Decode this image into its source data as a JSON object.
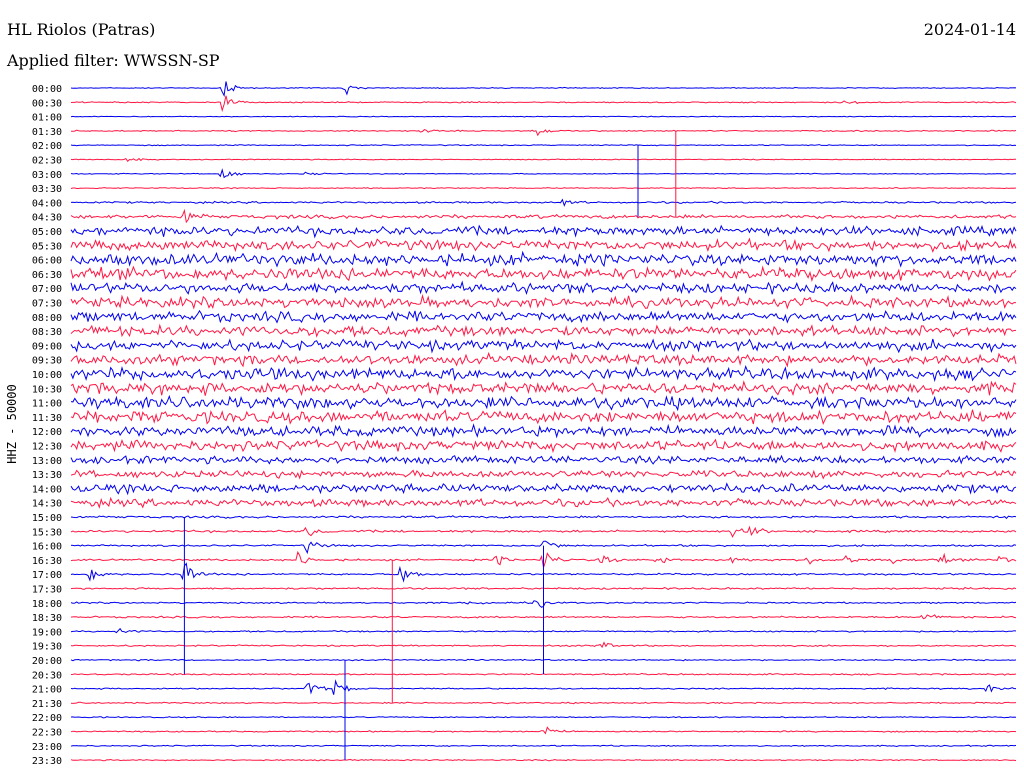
{
  "header": {
    "station": "HL Riolos (Patras)",
    "date": "2024-01-14",
    "filter": "Applied filter: WWSSN-SP"
  },
  "chart_data": {
    "type": "line",
    "title": "HL Riolos (Patras)",
    "ylabel": "HHZ - 50000",
    "colors": [
      "#0000ee",
      "#ff1744"
    ],
    "rows": [
      {
        "time": "00:00",
        "noise": 0.6
      },
      {
        "time": "00:30",
        "noise": 0.8
      },
      {
        "time": "01:00",
        "noise": 0.5
      },
      {
        "time": "01:30",
        "noise": 0.8
      },
      {
        "time": "02:00",
        "noise": 0.7
      },
      {
        "time": "02:30",
        "noise": 0.6
      },
      {
        "time": "03:00",
        "noise": 0.6
      },
      {
        "time": "03:30",
        "noise": 0.7
      },
      {
        "time": "04:00",
        "noise": 1.2
      },
      {
        "time": "04:30",
        "noise": 2.5
      },
      {
        "time": "05:00",
        "noise": 6
      },
      {
        "time": "05:30",
        "noise": 7
      },
      {
        "time": "06:00",
        "noise": 8
      },
      {
        "time": "06:30",
        "noise": 8
      },
      {
        "time": "07:00",
        "noise": 7
      },
      {
        "time": "07:30",
        "noise": 7
      },
      {
        "time": "08:00",
        "noise": 7
      },
      {
        "time": "08:30",
        "noise": 7
      },
      {
        "time": "09:00",
        "noise": 7
      },
      {
        "time": "09:30",
        "noise": 7
      },
      {
        "time": "10:00",
        "noise": 8
      },
      {
        "time": "10:30",
        "noise": 8
      },
      {
        "time": "11:00",
        "noise": 8
      },
      {
        "time": "11:30",
        "noise": 8
      },
      {
        "time": "12:00",
        "noise": 7
      },
      {
        "time": "12:30",
        "noise": 7
      },
      {
        "time": "13:00",
        "noise": 5
      },
      {
        "time": "13:30",
        "noise": 5
      },
      {
        "time": "14:00",
        "noise": 6
      },
      {
        "time": "14:30",
        "noise": 5
      },
      {
        "time": "15:00",
        "noise": 1.5
      },
      {
        "time": "15:30",
        "noise": 1.5
      },
      {
        "time": "16:00",
        "noise": 1.2
      },
      {
        "time": "16:30",
        "noise": 1.3
      },
      {
        "time": "17:00",
        "noise": 1.2
      },
      {
        "time": "17:30",
        "noise": 1.2
      },
      {
        "time": "18:00",
        "noise": 1.0
      },
      {
        "time": "18:30",
        "noise": 1.2
      },
      {
        "time": "19:00",
        "noise": 1.0
      },
      {
        "time": "19:30",
        "noise": 1.0
      },
      {
        "time": "20:00",
        "noise": 0.9
      },
      {
        "time": "20:30",
        "noise": 1.0
      },
      {
        "time": "21:00",
        "noise": 0.9
      },
      {
        "time": "21:30",
        "noise": 0.9
      },
      {
        "time": "22:00",
        "noise": 0.8
      },
      {
        "time": "22:30",
        "noise": 0.9
      },
      {
        "time": "23:00",
        "noise": 0.8
      },
      {
        "time": "23:30",
        "noise": 0.8
      }
    ],
    "events": [
      {
        "row": 0,
        "at": 0.16,
        "amp": 16
      },
      {
        "row": 1,
        "at": 0.16,
        "amp": 14
      },
      {
        "row": 0,
        "at": 0.29,
        "amp": 8
      },
      {
        "row": 1,
        "at": 0.82,
        "amp": 4
      },
      {
        "row": 3,
        "at": 0.49,
        "amp": 10
      },
      {
        "row": 3,
        "at": 0.37,
        "amp": 4
      },
      {
        "row": 6,
        "at": 0.16,
        "amp": 12
      },
      {
        "row": 6,
        "at": 0.25,
        "amp": 4
      },
      {
        "row": 5,
        "at": 0.06,
        "amp": 4
      },
      {
        "row": 8,
        "at": 0.52,
        "amp": 5
      },
      {
        "row": 9,
        "at": 0.12,
        "amp": 14
      },
      {
        "row": 33,
        "at": 0.24,
        "amp": 14
      },
      {
        "row": 32,
        "at": 0.25,
        "amp": 10
      },
      {
        "row": 34,
        "at": 0.12,
        "amp": 20
      },
      {
        "row": 34,
        "at": 0.02,
        "amp": 12
      },
      {
        "row": 34,
        "at": 0.35,
        "amp": 20
      },
      {
        "row": 33,
        "at": 0.5,
        "amp": 20
      },
      {
        "row": 32,
        "at": 0.5,
        "amp": 14
      },
      {
        "row": 36,
        "at": 0.49,
        "amp": 12
      },
      {
        "row": 36,
        "at": 0.42,
        "amp": 8
      },
      {
        "row": 37,
        "at": 0.9,
        "amp": 10
      },
      {
        "row": 38,
        "at": 0.05,
        "amp": 6
      },
      {
        "row": 39,
        "at": 0.56,
        "amp": 8
      },
      {
        "row": 42,
        "at": 0.25,
        "amp": 18
      },
      {
        "row": 42,
        "at": 0.28,
        "amp": 16
      },
      {
        "row": 45,
        "at": 0.5,
        "amp": 10
      },
      {
        "row": 42,
        "at": 0.97,
        "amp": 6
      },
      {
        "row": 31,
        "at": 0.25,
        "amp": 10
      },
      {
        "row": 31,
        "at": 0.7,
        "amp": 8
      },
      {
        "row": 31,
        "at": 0.72,
        "amp": 8
      },
      {
        "row": 33,
        "at": 0.45,
        "amp": 8
      },
      {
        "row": 33,
        "at": 0.56,
        "amp": 10
      },
      {
        "row": 33,
        "at": 0.62,
        "amp": 8
      },
      {
        "row": 33,
        "at": 0.7,
        "amp": 8
      },
      {
        "row": 33,
        "at": 0.78,
        "amp": 8
      },
      {
        "row": 33,
        "at": 0.82,
        "amp": 8
      },
      {
        "row": 33,
        "at": 0.87,
        "amp": 8
      },
      {
        "row": 33,
        "at": 0.92,
        "amp": 8
      },
      {
        "row": 33,
        "at": 0.98,
        "amp": 8
      }
    ],
    "spikes": [
      {
        "row": 4,
        "at": 0.6,
        "len": 5
      },
      {
        "row": 3,
        "at": 0.64,
        "len": 6
      },
      {
        "row": 30,
        "at": 0.12,
        "len": 11
      },
      {
        "row": 33,
        "at": 0.34,
        "len": 10
      },
      {
        "row": 32,
        "at": 0.5,
        "len": 9
      },
      {
        "row": 40,
        "at": 0.29,
        "len": 7
      }
    ]
  }
}
